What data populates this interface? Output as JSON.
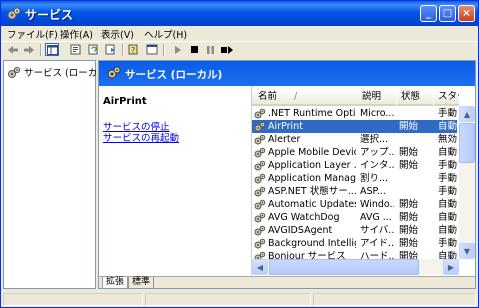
{
  "window": {
    "title": "サービス",
    "min_glyph": "_",
    "max_glyph": "□",
    "close_glyph": "×"
  },
  "menu": [
    {
      "label": "ファイル(F)",
      "name": "menu-file"
    },
    {
      "label": "操作(A)",
      "name": "menu-action"
    },
    {
      "label": "表示(V)",
      "name": "menu-view"
    },
    {
      "label": "ヘルプ(H)",
      "name": "menu-help"
    }
  ],
  "toolbar": {
    "back_icon": "back-arrow-icon",
    "forward_icon": "forward-arrow-icon"
  },
  "tree": {
    "item_label": "サービス (ローカル)"
  },
  "pane": {
    "header": "サービス (ローカル)",
    "selected_service": "AirPrint",
    "links": [
      "サービスの停止",
      "サービスの再起動"
    ]
  },
  "list": {
    "columns": [
      "名前",
      "説明",
      "状態",
      "スタートアップの種類"
    ],
    "sort_indicator": "/",
    "rows": [
      {
        "name": ".NET Runtime Opti...",
        "desc": "Micro...",
        "status": "",
        "startup": "手動"
      },
      {
        "name": "AirPrint",
        "desc": "",
        "status": "開始",
        "startup": "自動",
        "selected": true
      },
      {
        "name": "Alerter",
        "desc": "選択...",
        "status": "",
        "startup": "無効"
      },
      {
        "name": "Apple Mobile Device",
        "desc": "アップ...",
        "status": "開始",
        "startup": "自動"
      },
      {
        "name": "Application Layer ...",
        "desc": "インタ...",
        "status": "開始",
        "startup": "手動"
      },
      {
        "name": "Application Manage...",
        "desc": "割り...",
        "status": "",
        "startup": "手動"
      },
      {
        "name": "ASP.NET 状態サー...",
        "desc": "ASP...",
        "status": "",
        "startup": "手動"
      },
      {
        "name": "Automatic Updates",
        "desc": "Windo...",
        "status": "開始",
        "startup": "自動"
      },
      {
        "name": "AVG WatchDog",
        "desc": "AVG ...",
        "status": "開始",
        "startup": "自動"
      },
      {
        "name": "AVGIDSAgent",
        "desc": "サイバ...",
        "status": "開始",
        "startup": "自動"
      },
      {
        "name": "Background Intellig...",
        "desc": "アイド...",
        "status": "開始",
        "startup": "手動"
      },
      {
        "name": "Bonjour サービス",
        "desc": "ハード...",
        "status": "開始",
        "startup": "自動"
      }
    ]
  },
  "tabs": [
    "拡張",
    "標準"
  ],
  "colors": {
    "accent": "#316ac5",
    "title_bar": "#0055e5",
    "link": "#0000ee"
  }
}
